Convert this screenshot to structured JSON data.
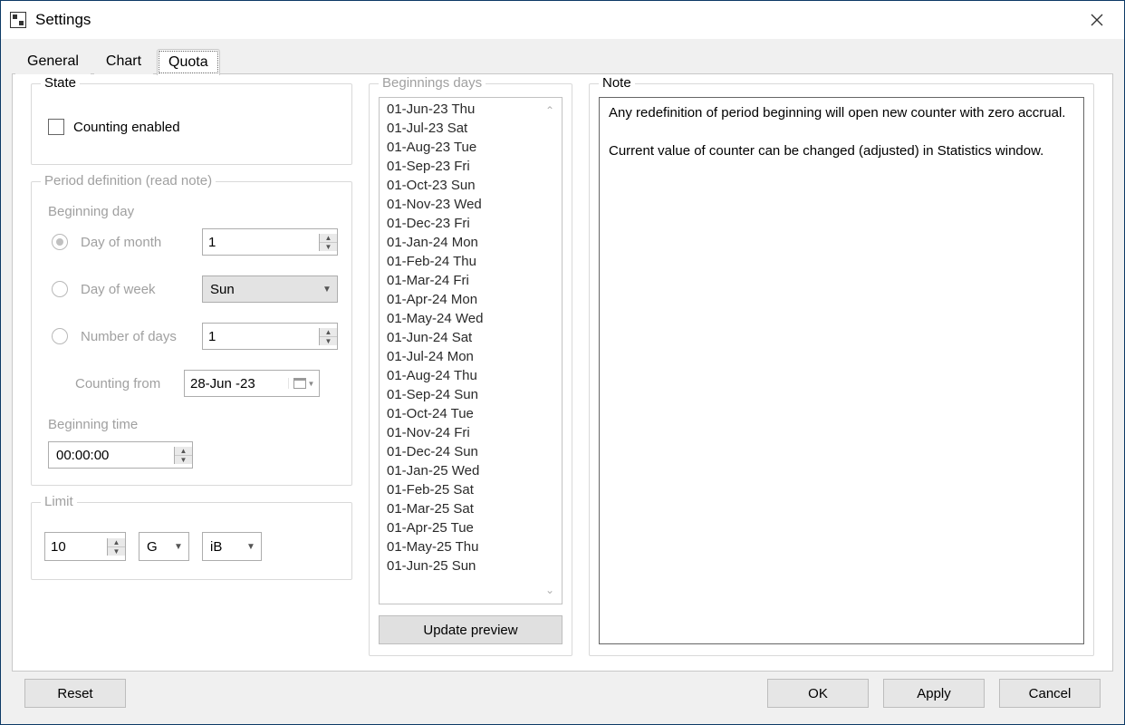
{
  "window": {
    "title": "Settings"
  },
  "tabs": [
    "General",
    "Chart",
    "Quota"
  ],
  "active_tab": "Quota",
  "state": {
    "group_label": "State",
    "counting_label": "Counting enabled",
    "counting_checked": false
  },
  "period": {
    "group_label": "Period definition (read note)",
    "beginning_day_label": "Beginning day",
    "options": {
      "day_of_month": {
        "label": "Day of month",
        "value": "1",
        "selected": true
      },
      "day_of_week": {
        "label": "Day of week",
        "value": "Sun",
        "selected": false
      },
      "number_of_days": {
        "label": "Number of days",
        "value": "1",
        "selected": false
      }
    },
    "counting_from": {
      "label": "Counting from",
      "value": "28-Jun -23"
    },
    "beginning_time": {
      "label": "Beginning time",
      "value": "00:00:00"
    }
  },
  "limit": {
    "group_label": "Limit",
    "amount": "10",
    "unit_prefix": "G",
    "unit_suffix": "iB"
  },
  "beginnings": {
    "group_label": "Beginnings days",
    "items": [
      "01-Jun-23 Thu",
      "01-Jul-23 Sat",
      "01-Aug-23 Tue",
      "01-Sep-23 Fri",
      "01-Oct-23 Sun",
      "01-Nov-23 Wed",
      "01-Dec-23 Fri",
      "01-Jan-24 Mon",
      "01-Feb-24 Thu",
      "01-Mar-24 Fri",
      "01-Apr-24 Mon",
      "01-May-24 Wed",
      "01-Jun-24 Sat",
      "01-Jul-24 Mon",
      "01-Aug-24 Thu",
      "01-Sep-24 Sun",
      "01-Oct-24 Tue",
      "01-Nov-24 Fri",
      "01-Dec-24 Sun",
      "01-Jan-25 Wed",
      "01-Feb-25 Sat",
      "01-Mar-25 Sat",
      "01-Apr-25 Tue",
      "01-May-25 Thu",
      "01-Jun-25 Sun"
    ],
    "update_label": "Update preview"
  },
  "note": {
    "group_label": "Note",
    "para1": "Any redefinition of period beginning will open new counter with zero accrual.",
    "para2": "Current value of counter can be changed (adjusted) in Statistics window."
  },
  "footer": {
    "reset": "Reset",
    "ok": "OK",
    "apply": "Apply",
    "cancel": "Cancel"
  }
}
